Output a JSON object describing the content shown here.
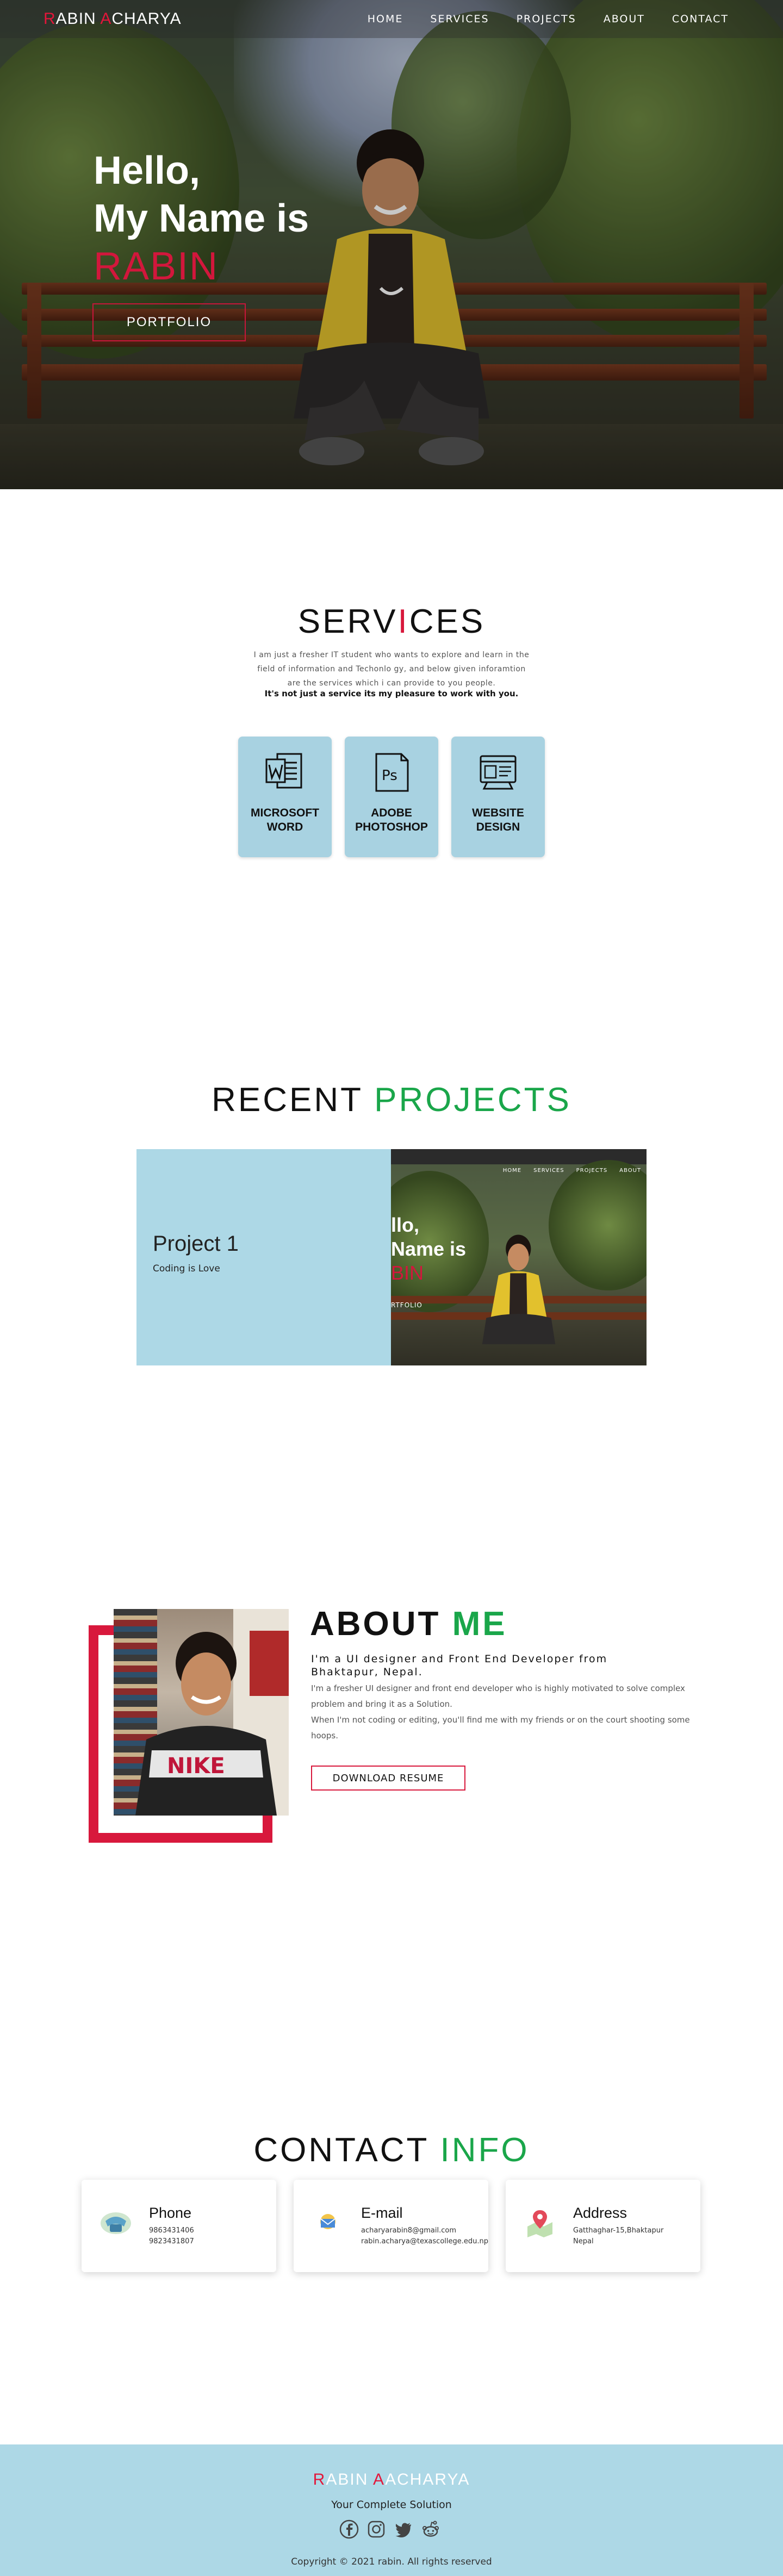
{
  "nav": {
    "logo_first": "R",
    "logo_mid": "ABIN ",
    "logo_a": "A",
    "logo_rest": "CHARYA",
    "items": [
      {
        "label": "HOME"
      },
      {
        "label": "SERVICES"
      },
      {
        "label": "PROJECTS"
      },
      {
        "label": "ABOUT"
      },
      {
        "label": "CONTACT"
      }
    ]
  },
  "hero": {
    "line1": "Hello,",
    "line2": "My Name is",
    "line3": "RABIN",
    "button": "PORTFOLIO"
  },
  "services": {
    "title_a": "SERV",
    "title_b": "I",
    "title_c": "CES",
    "desc": "I am just a fresher IT student who wants to explore and learn in the field of information and Techonlo gy, and below given inforamtion are the services which i can provide to you people.",
    "strong": "It's not just a service its my pleasure to work with you.",
    "cards": [
      {
        "label_1": "MICROSOFT",
        "label_2": "WORD",
        "icon": "word-icon"
      },
      {
        "label_1": "ADOBE",
        "label_2": "PHOTOSHOP",
        "icon": "photoshop-icon"
      },
      {
        "label_1": "WEBSITE",
        "label_2": "DESIGN",
        "icon": "website-design-icon"
      }
    ]
  },
  "projects": {
    "title_a": "RECENT ",
    "title_b": "PROJECTS",
    "items": [
      {
        "title": "Project 1",
        "subtitle": "Coding is Love"
      }
    ],
    "preview": {
      "nav": [
        "HOME",
        "SERVICES",
        "PROJECTS",
        "ABOUT"
      ],
      "line1": "llo,",
      "line2": "Name is",
      "line3": "BIN",
      "button": "RTFOLIO"
    }
  },
  "about": {
    "title_a": "ABOUT ",
    "title_b": "ME",
    "role": "I'm a UI designer and Front End Developer from Bhaktapur, Nepal.",
    "body_1": "I'm a fresher UI designer and front end developer who is highly motivated to solve complex problem and bring it as a Solution.",
    "body_2": "When I'm not coding or editing, you'll find me with my friends or on the court shooting some hoops.",
    "button": "DOWNLOAD RESUME",
    "shirt_text": "NIKE"
  },
  "contact": {
    "title_a": "CONTACT ",
    "title_b": "INFO",
    "cards": [
      {
        "title": "Phone",
        "line1": "9863431406",
        "line2": "9823431807",
        "icon": "phone-icon"
      },
      {
        "title": "E-mail",
        "line1": "acharyarabin8@gmail.com",
        "line2": "rabin.acharya@texascollege.edu.np",
        "icon": "email-icon"
      },
      {
        "title": "Address",
        "line1": "Gatthaghar-15,Bhaktapur",
        "line2": "Nepal",
        "icon": "location-icon"
      }
    ]
  },
  "footer": {
    "logo_r": "R",
    "logo_mid": "ABIN ",
    "logo_a": "A",
    "logo_rest": "ACHARYA",
    "tagline": "Your Complete Solution",
    "socials": [
      "facebook-icon",
      "instagram-icon",
      "twitter-icon",
      "reddit-icon"
    ],
    "copyright": "Copyright © 2021 rabin. All rights reserved"
  },
  "colors": {
    "accent_red": "#d8183c",
    "accent_green": "#1aa64a",
    "card_blue": "#a8d2e1",
    "footer_blue": "#add8e6"
  }
}
